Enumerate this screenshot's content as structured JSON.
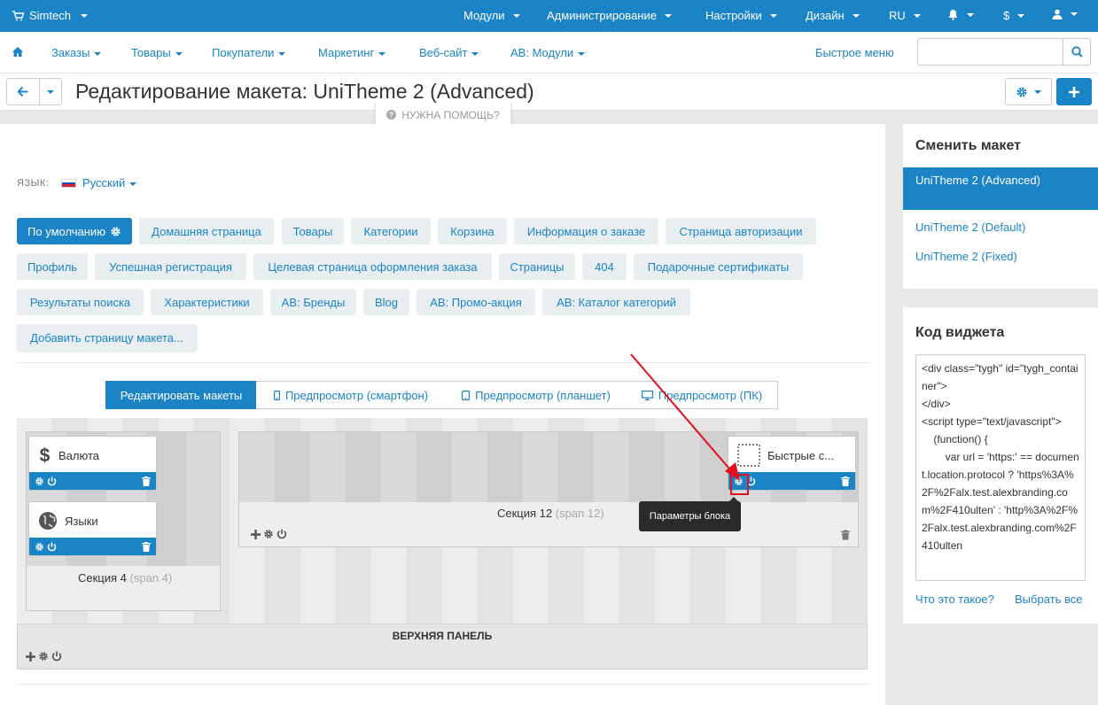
{
  "topbar": {
    "brand": "Simtech",
    "nav": [
      "Модули",
      "Администрирование",
      "Настройки",
      "Дизайн",
      "RU",
      "$"
    ]
  },
  "mainnav": {
    "items": [
      "Заказы",
      "Товары",
      "Покупатели",
      "Маркетинг",
      "Веб-сайт",
      "AB: Модули"
    ],
    "quick_menu": "Быстрое меню",
    "search_placeholder": ""
  },
  "title": "Редактирование макета: UniTheme 2 (Advanced)",
  "help": "НУЖНА ПОМОЩЬ?",
  "language": {
    "label": "ЯЗЫК:",
    "value": "Русский"
  },
  "page_tabs": [
    "По умолчанию",
    "Домашняя страница",
    "Товары",
    "Категории",
    "Корзина",
    "Информация о заказе",
    "Страница авторизации",
    "Профиль",
    "Успешная регистрация",
    "Целевая страница оформления заказа",
    "Страницы",
    "404",
    "Подарочные сертификаты",
    "Результаты поиска",
    "Характеристики",
    "AB: Бренды",
    "Blog",
    "AB: Промо-акция",
    "AB: Каталог категорий",
    "Добавить страницу макета..."
  ],
  "modes": [
    "Редактировать макеты",
    "Предпросмотр (смартфон)",
    "Предпросмотр (планшет)",
    "Предпросмотр (ПК)"
  ],
  "section4": {
    "label": "Секция 4",
    "span": "(span 4)",
    "blocks": [
      "Валюта",
      "Языки"
    ]
  },
  "section12": {
    "label": "Секция 12",
    "span": "(span 12)",
    "blocks": [
      "Быстрые с..."
    ]
  },
  "top_panel": "ВЕРХНЯЯ ПАНЕЛЬ",
  "tooltip": "Параметры блока",
  "sidebar": {
    "change_layout_title": "Сменить макет",
    "layouts": [
      "UniTheme 2 (Advanced)",
      "UniTheme 2 (Default)",
      "UniTheme 2 (Fixed)"
    ],
    "widget_title": "Код виджета",
    "widget_code": "<div class=\"tygh\" id=\"tygh_container\">\n</div>\n<script type=\"text/javascript\">\n    (function() {\n        var url = 'https:' == document.location.protocol ? 'https%3A%2F%2Falx.test.alexbranding.com%2F410ulten' : 'http%3A%2F%2Falx.test.alexbranding.com%2F410ulten",
    "what_is_it": "Что это такое?",
    "select_all": "Выбрать все"
  },
  "colors": {
    "accent": "#1a84c7",
    "highlight": "#e1101e"
  }
}
